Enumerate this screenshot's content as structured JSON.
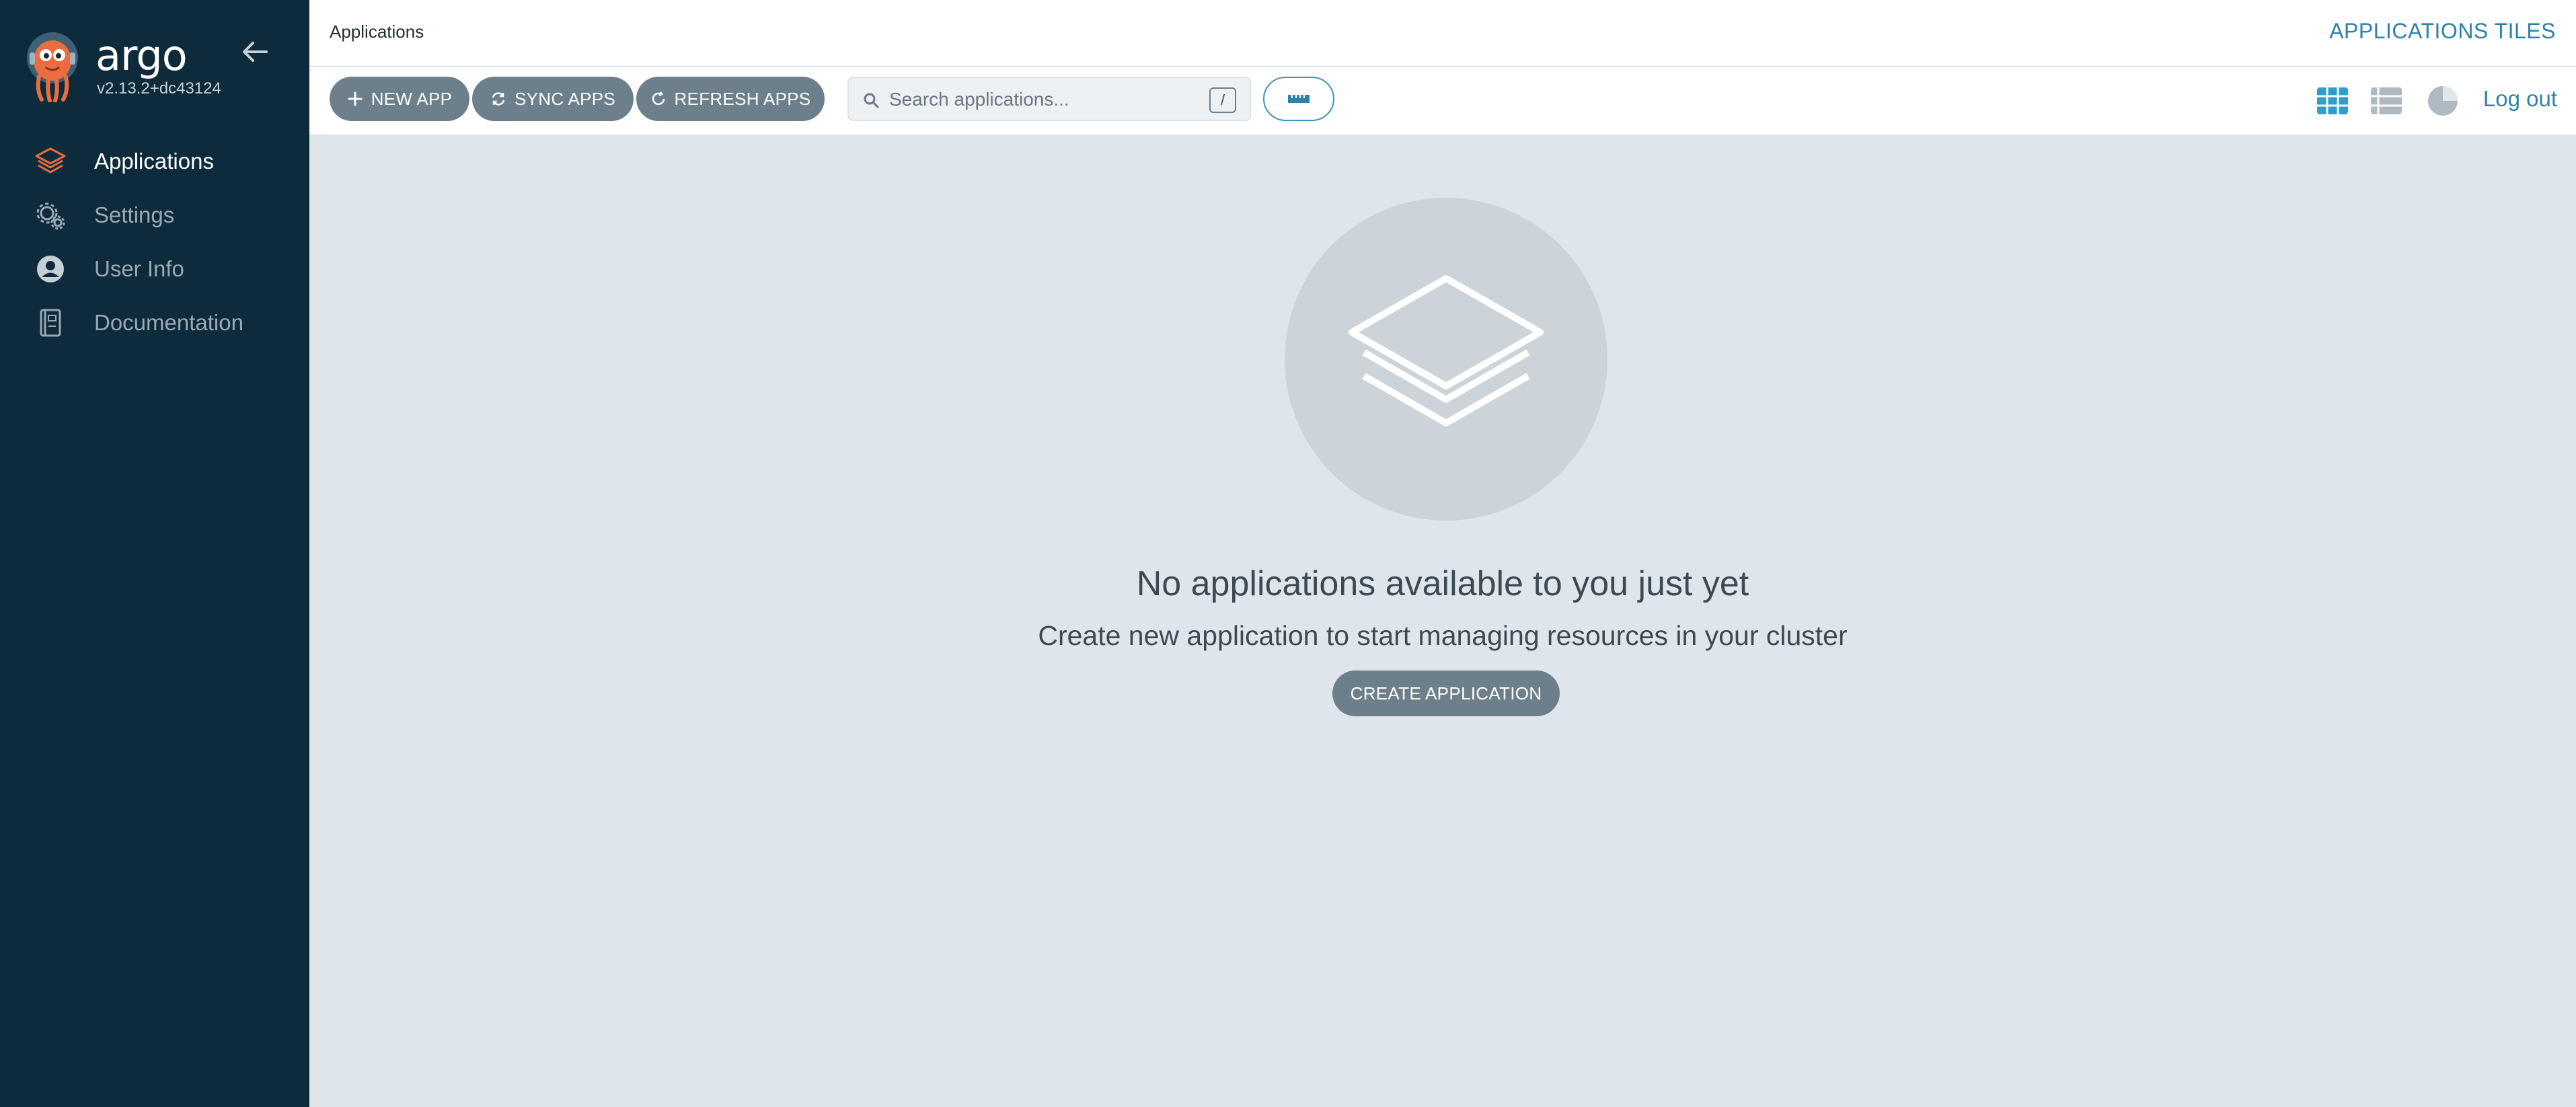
{
  "sidebar": {
    "brand_name": "argo",
    "version": "v2.13.2+dc43124",
    "items": [
      {
        "label": "Applications",
        "icon": "layers-icon",
        "active": true
      },
      {
        "label": "Settings",
        "icon": "gears-icon",
        "active": false
      },
      {
        "label": "User Info",
        "icon": "user-circle-icon",
        "active": false
      },
      {
        "label": "Documentation",
        "icon": "book-icon",
        "active": false
      }
    ]
  },
  "header": {
    "breadcrumb": "Applications",
    "page_title": "APPLICATIONS TILES"
  },
  "toolbar": {
    "new_app": "NEW APP",
    "sync_apps": "SYNC APPS",
    "refresh_apps": "REFRESH APPS",
    "search_placeholder": "Search applications...",
    "search_shortcut": "/",
    "logout": "Log out",
    "views": [
      "tiles-view-icon",
      "list-view-icon",
      "summary-pie-icon"
    ]
  },
  "empty_state": {
    "title": "No applications available to you just yet",
    "subtitle": "Create new application to start managing resources in your cluster",
    "button": "CREATE APPLICATION"
  },
  "colors": {
    "sidebar_bg": "#0e2b3c",
    "accent": "#2e82a7",
    "button_gray": "#6d7f8b",
    "content_bg": "#dee6eb",
    "logo_orange": "#e96d3e"
  }
}
